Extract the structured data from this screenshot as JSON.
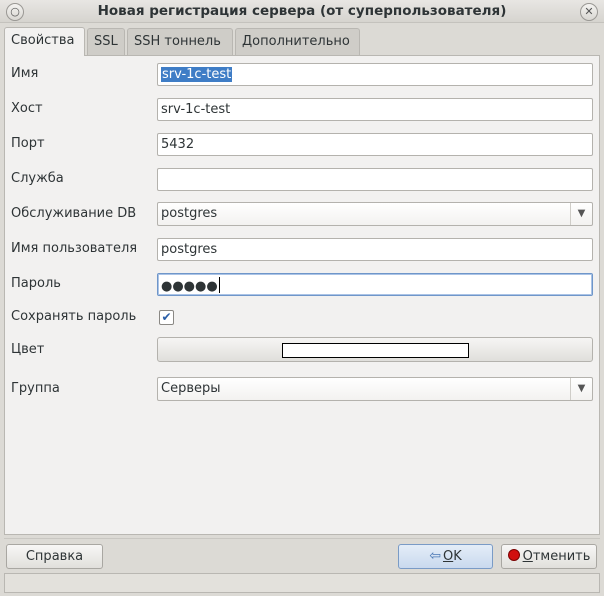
{
  "window": {
    "title": "Новая регистрация сервера (от суперпользователя)",
    "menu_icon": "circle-icon",
    "close_icon": "close-icon"
  },
  "tabs": [
    {
      "label": "Свойства",
      "active": true
    },
    {
      "label": "SSL",
      "active": false
    },
    {
      "label": "SSH тоннель",
      "active": false
    },
    {
      "label": "Дополнительно",
      "active": false
    }
  ],
  "form": {
    "name": {
      "label": "Имя",
      "value": "srv-1c-test"
    },
    "host": {
      "label": "Хост",
      "value": "srv-1c-test"
    },
    "port": {
      "label": "Порт",
      "value": "5432"
    },
    "service": {
      "label": "Служба",
      "value": ""
    },
    "maintenance_db": {
      "label": "Обслуживание DB",
      "value": "postgres"
    },
    "username": {
      "label": "Имя пользователя",
      "value": "postgres"
    },
    "password": {
      "label": "Пароль",
      "value": "●●●●●"
    },
    "save_password": {
      "label": "Сохранять пароль",
      "checked": true,
      "mark": "✔"
    },
    "color": {
      "label": "Цвет",
      "swatch": "#ffffff"
    },
    "group": {
      "label": "Группа",
      "value": "Серверы"
    }
  },
  "buttons": {
    "help": "Справка",
    "ok_prefix": "",
    "ok_underlined": "О",
    "ok_rest": "K",
    "cancel_underlined": "О",
    "cancel_rest": "тменить"
  },
  "colors": {
    "selection": "#3f7dc6",
    "focus_border": "#6f96c9",
    "cancel_icon": "#d10f0f"
  }
}
